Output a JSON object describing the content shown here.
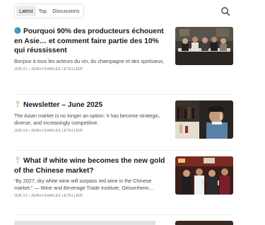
{
  "tabs": [
    {
      "label": "Latest",
      "active": true
    },
    {
      "label": "Top",
      "active": false
    },
    {
      "label": "Discussions",
      "active": false
    }
  ],
  "search": {
    "icon": "search-icon"
  },
  "articles": [
    {
      "emoji": "globe-icon",
      "title": "Pourquoi 90% des producteurs échouent en Asie… et comment faire partie des 10% qui réussissent",
      "subtitle": "Bonjour à tous les acteurs du vin, du champagne et des spiritueux,",
      "date": "JUN 21",
      "author": "JEAN-CHARLES LETELLIER",
      "meta": "JUN 21 • JEAN-CHARLES LETELLIER"
    },
    {
      "emoji": "wine-glass-icon",
      "title": "Newsletter – June 2025",
      "subtitle": "The Asian market is no longer an option: it has become strategic, diverse, and increasingly competitive.",
      "date": "JUN 19",
      "author": "JEAN-CHARLES LETELLIER",
      "meta": "JUN 19 • JEAN-CHARLES LETELLIER"
    },
    {
      "emoji": "wine-glass-icon",
      "title": "What if white wine becomes the new gold of the Chinese market?",
      "subtitle": "“By 2027, dry white wine will surpass red wine in the Chinese market.” — Wine and Beverage Trade Institute, Geisenheim…",
      "date": "JUN 13",
      "author": "JEAN-CHARLES LETELLIER",
      "meta": "JUN 13 • JEAN-CHARLES LETELLIER"
    }
  ]
}
